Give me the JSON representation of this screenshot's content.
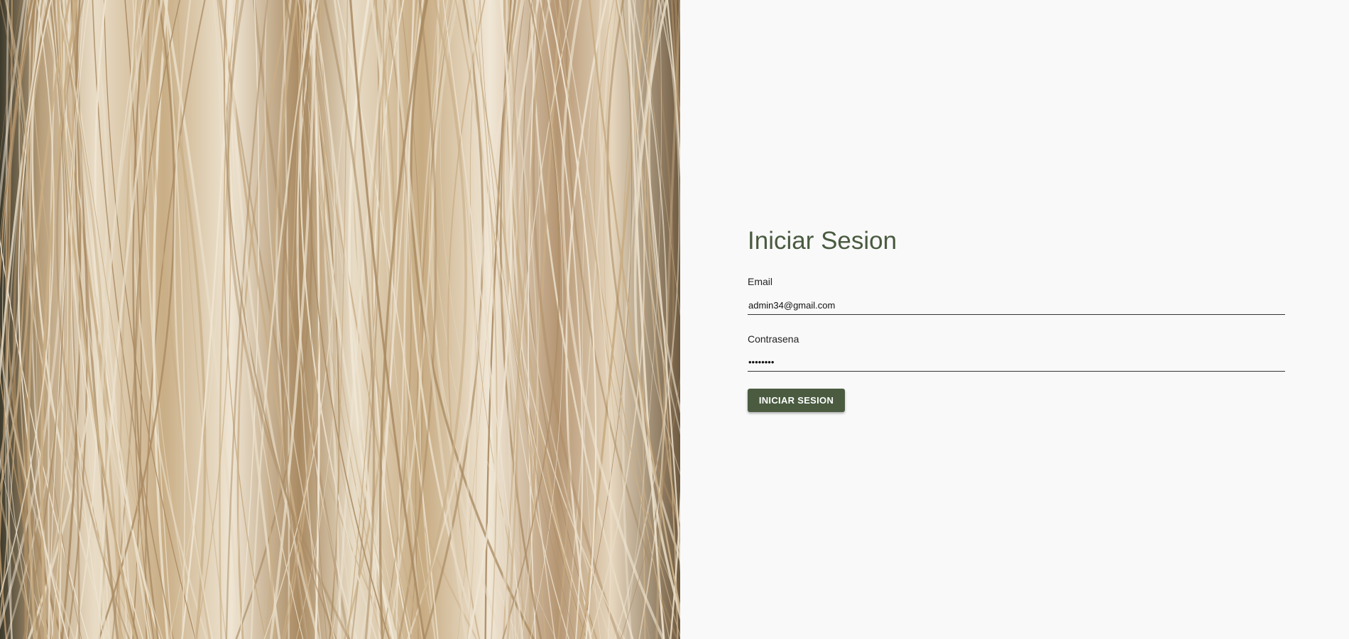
{
  "login": {
    "title": "Iniciar Sesion",
    "email_label": "Email",
    "email_value": "admin34@gmail.com",
    "password_label": "Contrasena",
    "password_value": "12345678",
    "submit_label": "INICIAR SESION"
  },
  "hero": {
    "image_icon": "fiber-photo",
    "colors": [
      "#efe5d3",
      "#c9ae86",
      "#a98a62",
      "#e8dcc6"
    ]
  },
  "theme": {
    "accent": "#4a5b40",
    "background": "#f9f9f9"
  }
}
